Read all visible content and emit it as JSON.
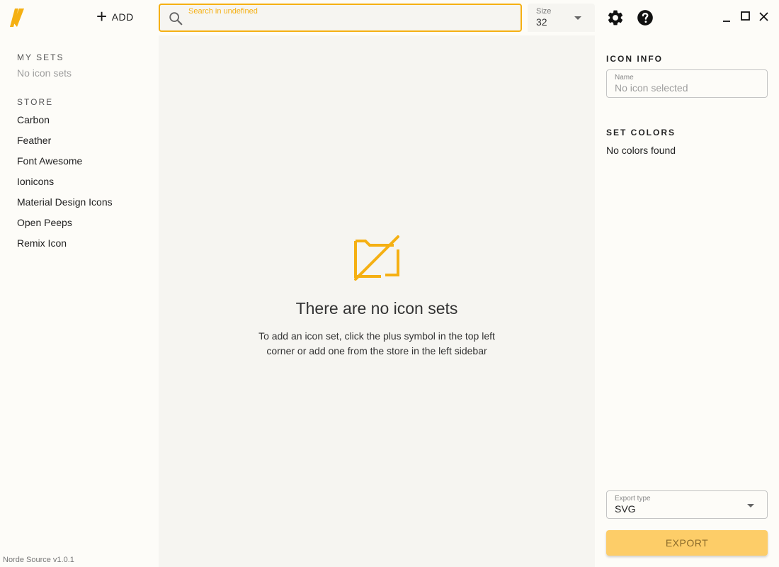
{
  "theme": {
    "accent": "#f5b013",
    "export_bg": "#fdcd68"
  },
  "sidebar": {
    "add_label": "ADD",
    "my_sets_title": "MY SETS",
    "my_sets_empty": "No icon sets",
    "store_title": "STORE",
    "store_items": [
      "Carbon",
      "Feather",
      "Font Awesome",
      "Ionicons",
      "Material Design Icons",
      "Open Peeps",
      "Remix Icon"
    ],
    "version": "Norde Source v1.0.1"
  },
  "search": {
    "label": "Search in undefined",
    "value": ""
  },
  "size": {
    "label": "Size",
    "value": "32"
  },
  "main": {
    "empty_title": "There are no icon sets",
    "empty_desc": "To add an icon set, click the plus symbol in the top left corner or add one from the store in the left sidebar"
  },
  "right_panel": {
    "icon_info_title": "ICON INFO",
    "name_label": "Name",
    "name_value": "No icon selected",
    "set_colors_title": "SET COLORS",
    "no_colors": "No colors found",
    "export_type_label": "Export type",
    "export_type_value": "SVG",
    "export_label": "EXPORT"
  },
  "icons": {
    "logo": "app-logo",
    "add": "plus-icon",
    "search": "search-icon",
    "settings": "gear-icon",
    "help": "help-icon",
    "empty_state": "folder-off-icon",
    "minimize": "minimize-icon",
    "maximize": "maximize-icon",
    "close": "close-icon"
  }
}
